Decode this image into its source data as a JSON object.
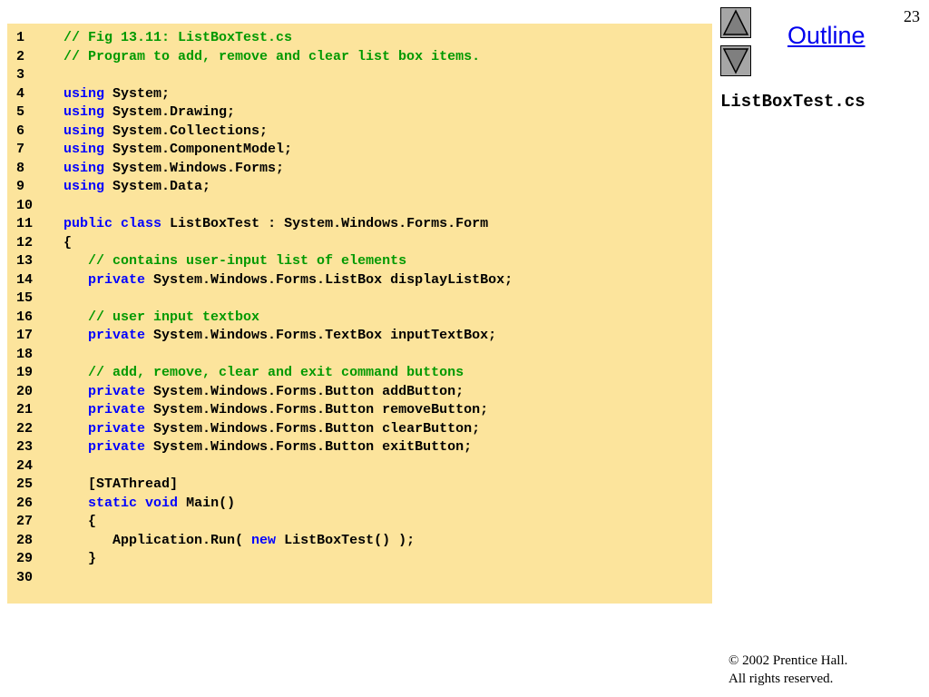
{
  "page_number": "23",
  "outline_label": "Outline",
  "file_name": "ListBoxTest.cs",
  "footer": {
    "copyright_symbol": "©",
    "copyright_text": " 2002 Prentice Hall.",
    "rights": "All rights reserved."
  },
  "icons": {
    "prev": "triangle-up-icon",
    "next": "triangle-down-icon"
  },
  "colors": {
    "code_background": "#fce49c",
    "keyword": "#0000ff",
    "comment": "#009900",
    "outline_link": "#0000ee",
    "arrow_button": "#a6a6a6"
  },
  "code_lines": [
    {
      "num": "1",
      "parts": [
        {
          "t": "cm",
          "v": "// Fig 13.11: ListBoxTest.cs"
        }
      ]
    },
    {
      "num": "2",
      "parts": [
        {
          "t": "cm",
          "v": "// Program to add, remove and clear list box items."
        }
      ]
    },
    {
      "num": "3",
      "parts": []
    },
    {
      "num": "4",
      "parts": [
        {
          "t": "kw",
          "v": "using"
        },
        {
          "t": "tx",
          "v": " System;"
        }
      ]
    },
    {
      "num": "5",
      "parts": [
        {
          "t": "kw",
          "v": "using"
        },
        {
          "t": "tx",
          "v": " System.Drawing;"
        }
      ]
    },
    {
      "num": "6",
      "parts": [
        {
          "t": "kw",
          "v": "using"
        },
        {
          "t": "tx",
          "v": " System.Collections;"
        }
      ]
    },
    {
      "num": "7",
      "parts": [
        {
          "t": "kw",
          "v": "using"
        },
        {
          "t": "tx",
          "v": " System.ComponentModel;"
        }
      ]
    },
    {
      "num": "8",
      "parts": [
        {
          "t": "kw",
          "v": "using"
        },
        {
          "t": "tx",
          "v": " System.Windows.Forms;"
        }
      ]
    },
    {
      "num": "9",
      "parts": [
        {
          "t": "kw",
          "v": "using"
        },
        {
          "t": "tx",
          "v": " System.Data;"
        }
      ]
    },
    {
      "num": "10",
      "parts": []
    },
    {
      "num": "11",
      "parts": [
        {
          "t": "kw",
          "v": "public"
        },
        {
          "t": "tx",
          "v": " "
        },
        {
          "t": "kw",
          "v": "class"
        },
        {
          "t": "tx",
          "v": " ListBoxTest : System.Windows.Forms.Form"
        }
      ]
    },
    {
      "num": "12",
      "parts": [
        {
          "t": "tx",
          "v": "{"
        }
      ]
    },
    {
      "num": "13",
      "parts": [
        {
          "t": "tx",
          "v": "   "
        },
        {
          "t": "cm",
          "v": "// contains user-input list of elements"
        }
      ]
    },
    {
      "num": "14",
      "parts": [
        {
          "t": "tx",
          "v": "   "
        },
        {
          "t": "kw",
          "v": "private"
        },
        {
          "t": "tx",
          "v": " System.Windows.Forms.ListBox displayListBox;"
        }
      ]
    },
    {
      "num": "15",
      "parts": []
    },
    {
      "num": "16",
      "parts": [
        {
          "t": "tx",
          "v": "   "
        },
        {
          "t": "cm",
          "v": "// user input textbox"
        }
      ]
    },
    {
      "num": "17",
      "parts": [
        {
          "t": "tx",
          "v": "   "
        },
        {
          "t": "kw",
          "v": "private"
        },
        {
          "t": "tx",
          "v": " System.Windows.Forms.TextBox inputTextBox;"
        }
      ]
    },
    {
      "num": "18",
      "parts": []
    },
    {
      "num": "19",
      "parts": [
        {
          "t": "tx",
          "v": "   "
        },
        {
          "t": "cm",
          "v": "// add, remove, clear and exit command buttons"
        }
      ]
    },
    {
      "num": "20",
      "parts": [
        {
          "t": "tx",
          "v": "   "
        },
        {
          "t": "kw",
          "v": "private"
        },
        {
          "t": "tx",
          "v": " System.Windows.Forms.Button addButton;"
        }
      ]
    },
    {
      "num": "21",
      "parts": [
        {
          "t": "tx",
          "v": "   "
        },
        {
          "t": "kw",
          "v": "private"
        },
        {
          "t": "tx",
          "v": " System.Windows.Forms.Button removeButton;"
        }
      ]
    },
    {
      "num": "22",
      "parts": [
        {
          "t": "tx",
          "v": "   "
        },
        {
          "t": "kw",
          "v": "private"
        },
        {
          "t": "tx",
          "v": " System.Windows.Forms.Button clearButton;"
        }
      ]
    },
    {
      "num": "23",
      "parts": [
        {
          "t": "tx",
          "v": "   "
        },
        {
          "t": "kw",
          "v": "private"
        },
        {
          "t": "tx",
          "v": " System.Windows.Forms.Button exitButton;"
        }
      ]
    },
    {
      "num": "24",
      "parts": []
    },
    {
      "num": "25",
      "parts": [
        {
          "t": "tx",
          "v": "   [STAThread]"
        }
      ]
    },
    {
      "num": "26",
      "parts": [
        {
          "t": "tx",
          "v": "   "
        },
        {
          "t": "kw",
          "v": "static"
        },
        {
          "t": "tx",
          "v": " "
        },
        {
          "t": "kw",
          "v": "void"
        },
        {
          "t": "tx",
          "v": " Main()"
        }
      ]
    },
    {
      "num": "27",
      "parts": [
        {
          "t": "tx",
          "v": "   {"
        }
      ]
    },
    {
      "num": "28",
      "parts": [
        {
          "t": "tx",
          "v": "      Application.Run( "
        },
        {
          "t": "kw",
          "v": "new"
        },
        {
          "t": "tx",
          "v": " ListBoxTest() );"
        }
      ]
    },
    {
      "num": "29",
      "parts": [
        {
          "t": "tx",
          "v": "   }"
        }
      ]
    },
    {
      "num": "30",
      "parts": []
    }
  ]
}
